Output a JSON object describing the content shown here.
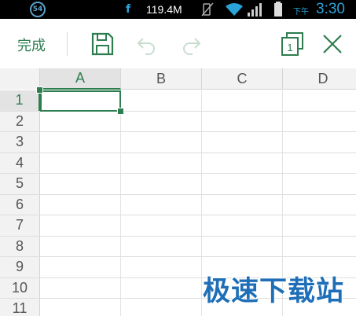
{
  "status_bar": {
    "badge": "54",
    "carrier_glyph": "f",
    "speed": "119.4M",
    "ampm": "下午",
    "time": "3:30"
  },
  "toolbar": {
    "done_label": "完成",
    "sheet_count": "1"
  },
  "sheet": {
    "columns": [
      "A",
      "B",
      "C",
      "D"
    ],
    "rows": [
      "1",
      "2",
      "3",
      "4",
      "5",
      "6",
      "7",
      "8",
      "9",
      "10",
      "11"
    ],
    "selected_cell": "A1"
  },
  "watermark": "极速下载站",
  "colors": {
    "accent": "#2e7d4f",
    "status_blue": "#2aa4d8",
    "watermark_blue": "#1f6fb8"
  }
}
